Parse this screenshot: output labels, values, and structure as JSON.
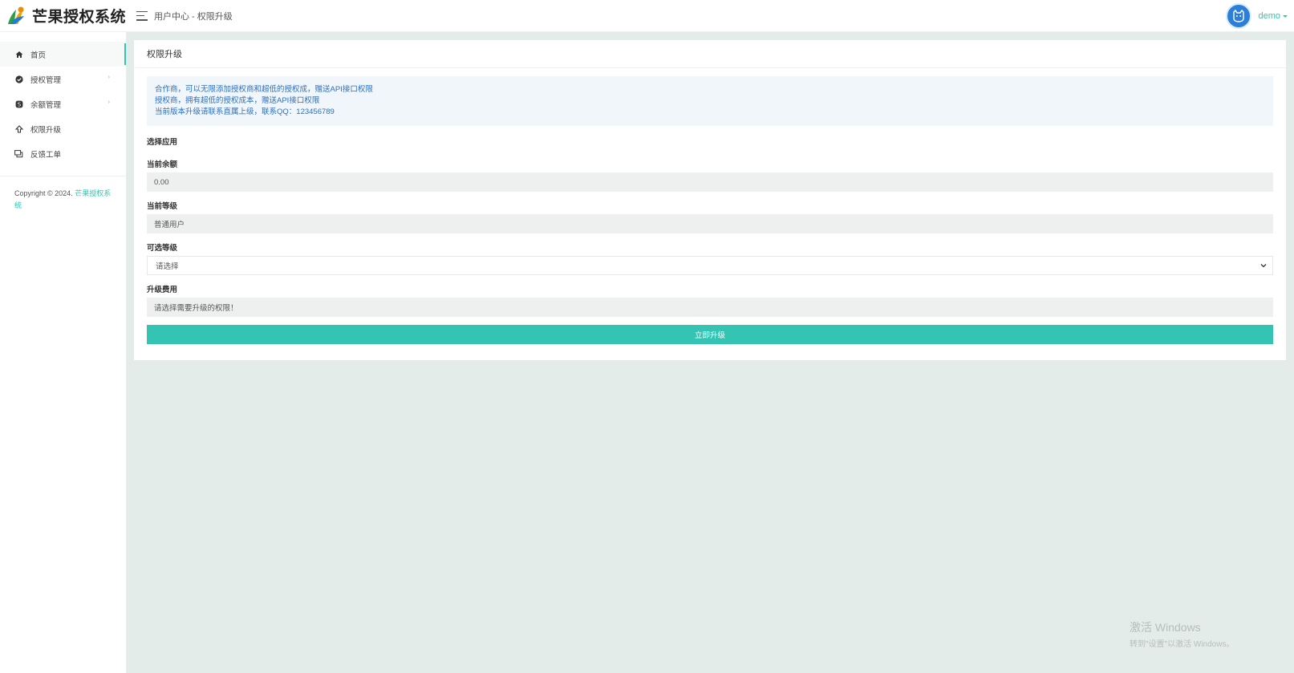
{
  "brand": {
    "name": "芒果授权系统"
  },
  "header": {
    "breadcrumb": "用户中心 - 权限升级",
    "username": "demo"
  },
  "sidebar": {
    "items": [
      {
        "label": "首页",
        "icon": "home-icon"
      },
      {
        "label": "授权管理",
        "icon": "check-circle-icon"
      },
      {
        "label": "余额管理",
        "icon": "coin-icon"
      },
      {
        "label": "权限升级",
        "icon": "upgrade-icon"
      },
      {
        "label": "反馈工单",
        "icon": "feedback-icon"
      }
    ],
    "copyright_prefix": "Copyright © 2024. ",
    "copyright_link": "芒果授权系统"
  },
  "card": {
    "title": "权限升级",
    "notice": [
      "合作商，可以无限添加授权商和超低的授权成，赠送API接口权限",
      "授权商，拥有超低的授权成本，赠送API接口权限",
      "当前版本升级请联系直属上级，联系QQ：123456789"
    ],
    "select_app_label": "选择应用",
    "balance_label": "当前余额",
    "balance_value": "0.00",
    "level_label": "当前等级",
    "level_value": "普通用户",
    "optional_level_label": "可选等级",
    "optional_level_value": "请选择",
    "fee_label": "升级费用",
    "fee_value": "请选择需要升级的权限！",
    "submit_label": "立即升级"
  },
  "watermark": {
    "line1": "激活 Windows",
    "line2": "转到\"设置\"以激活 Windows。"
  },
  "colors": {
    "accent": "#33c4b3",
    "notice_text": "#2c6fc2",
    "avatar": "#2b7fd9"
  }
}
